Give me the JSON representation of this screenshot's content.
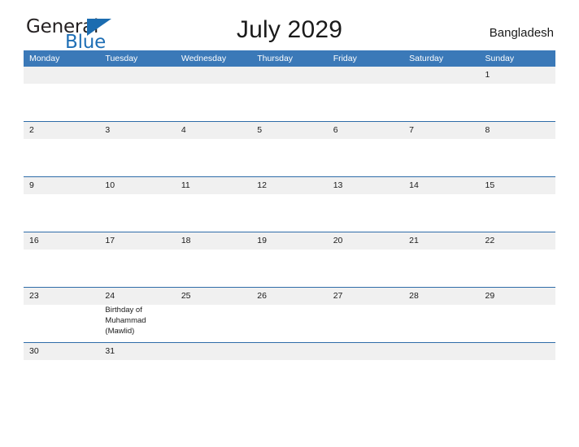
{
  "brand": {
    "name_part1": "General",
    "name_part2": "Blue",
    "triangle_color": "#1b6cb0"
  },
  "header": {
    "title": "July 2029",
    "country": "Bangladesh"
  },
  "calendar": {
    "header_color": "#3b79b8",
    "band_color": "#f0f0f0",
    "separator_color": "#2e6ca8",
    "weekdays": [
      "Monday",
      "Tuesday",
      "Wednesday",
      "Thursday",
      "Friday",
      "Saturday",
      "Sunday"
    ],
    "weeks": [
      [
        {
          "day": ""
        },
        {
          "day": ""
        },
        {
          "day": ""
        },
        {
          "day": ""
        },
        {
          "day": ""
        },
        {
          "day": ""
        },
        {
          "day": "1"
        }
      ],
      [
        {
          "day": "2"
        },
        {
          "day": "3"
        },
        {
          "day": "4"
        },
        {
          "day": "5"
        },
        {
          "day": "6"
        },
        {
          "day": "7"
        },
        {
          "day": "8"
        }
      ],
      [
        {
          "day": "9"
        },
        {
          "day": "10"
        },
        {
          "day": "11"
        },
        {
          "day": "12"
        },
        {
          "day": "13"
        },
        {
          "day": "14"
        },
        {
          "day": "15"
        }
      ],
      [
        {
          "day": "16"
        },
        {
          "day": "17"
        },
        {
          "day": "18"
        },
        {
          "day": "19"
        },
        {
          "day": "20"
        },
        {
          "day": "21"
        },
        {
          "day": "22"
        }
      ],
      [
        {
          "day": "23"
        },
        {
          "day": "24",
          "event": "Birthday of Muhammad (Mawlid)"
        },
        {
          "day": "25"
        },
        {
          "day": "26"
        },
        {
          "day": "27"
        },
        {
          "day": "28"
        },
        {
          "day": "29"
        }
      ],
      [
        {
          "day": "30"
        },
        {
          "day": "31"
        },
        {
          "day": ""
        },
        {
          "day": ""
        },
        {
          "day": ""
        },
        {
          "day": ""
        },
        {
          "day": ""
        }
      ]
    ]
  }
}
